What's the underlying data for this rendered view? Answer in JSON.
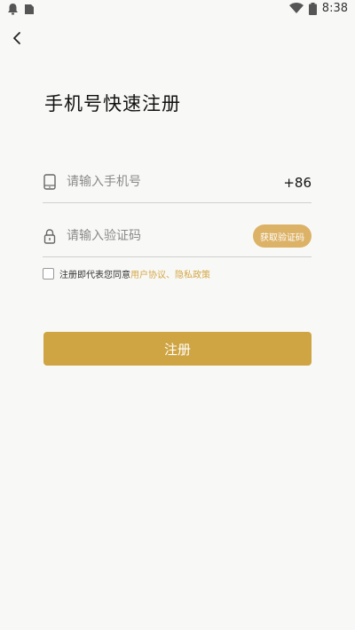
{
  "status_bar": {
    "time": "8:38",
    "icons_left": [
      "notification-bell-icon",
      "sim-card-icon"
    ],
    "icons_right": [
      "wifi-icon",
      "battery-icon"
    ]
  },
  "header": {
    "back_icon": "chevron-left-icon"
  },
  "page": {
    "title": "手机号快速注册"
  },
  "phone_field": {
    "icon": "phone-icon",
    "placeholder": "请输入手机号",
    "value": "",
    "country_code": "+86"
  },
  "code_field": {
    "icon": "lock-icon",
    "placeholder": "请输入验证码",
    "value": "",
    "get_code_label": "获取验证码"
  },
  "agreement": {
    "checked": false,
    "text": "注册即代表您同意",
    "links": "用户协议、隐私政策"
  },
  "register_button": {
    "label": "注册"
  },
  "colors": {
    "background": "#f8f9f6",
    "primary_button": "#cfa442",
    "code_button": "#dcb267",
    "link": "#d4a647",
    "divider": "#cfcfcf"
  }
}
